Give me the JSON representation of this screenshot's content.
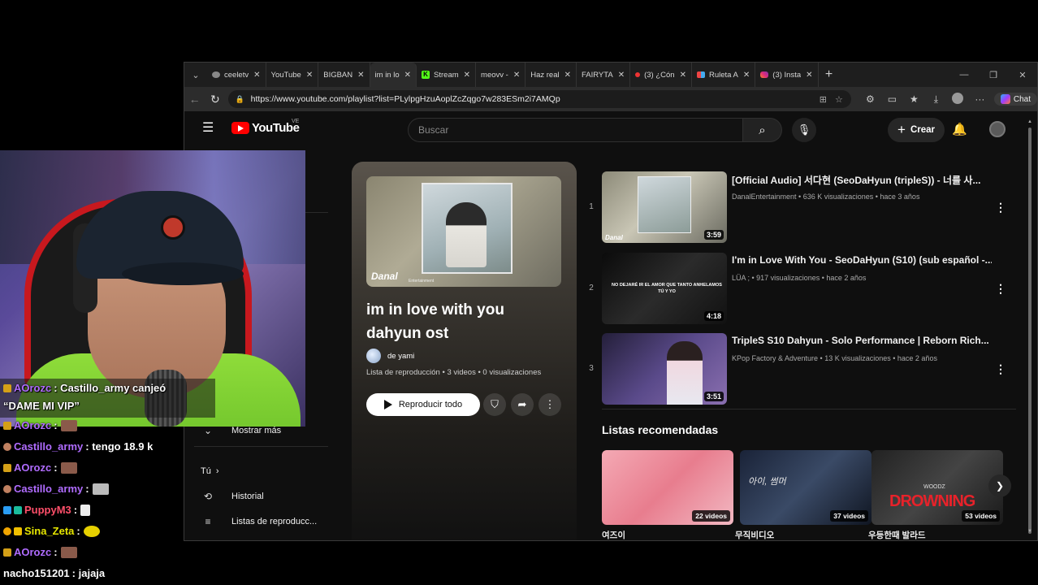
{
  "browser": {
    "tabs": [
      {
        "label": "ceeletv",
        "icon": "github-icon",
        "active": false
      },
      {
        "label": "YouTube",
        "icon": "youtube-icon",
        "active": false
      },
      {
        "label": "BIGBAN",
        "icon": "youtube-icon",
        "active": false
      },
      {
        "label": "im in lo",
        "icon": "youtube-icon",
        "active": true
      },
      {
        "label": "Stream",
        "icon": "kick-icon",
        "active": false
      },
      {
        "label": "meovv -",
        "icon": "youtube-icon",
        "active": false
      },
      {
        "label": "Haz real",
        "icon": "youtube-icon",
        "active": false
      },
      {
        "label": "FAIRYTA",
        "icon": "youtube-icon",
        "active": false
      },
      {
        "label": "(3) ¿Cón",
        "icon": "dot-icon",
        "active": false
      },
      {
        "label": "Ruleta A",
        "icon": "grid-icon",
        "active": false
      },
      {
        "label": "(3) Insta",
        "icon": "instagram-icon",
        "active": false
      }
    ],
    "url": "https://www.youtube.com/playlist?list=PLylpgHzuAoplZcZqgo7w283ESm2i7AMQp",
    "chat_label": "Chat"
  },
  "youtube": {
    "logo_text": "YouTube",
    "country_code": "VE",
    "search_placeholder": "Buscar",
    "create_label": "Crear",
    "sidebar": {
      "show_more": "Mostrar más",
      "you": "Tú",
      "history": "Historial",
      "playlists": "Listas de reproducc..."
    },
    "playlist": {
      "thumb_brand": "Danal",
      "thumb_brand_sub": "Entertainment",
      "title": "im in love with you dahyun ost",
      "owner": "de yami",
      "meta": "Lista de reproducción • 3 videos • 0 visualizaciones",
      "play_all": "Reproducir todo"
    },
    "videos": [
      {
        "index": "1",
        "title": "[Official Audio] 서다현 (SeoDaHyun (tripleS)) - 너를 사...",
        "meta": "DanalEntertainment • 636 K visualizaciones • hace 3 años",
        "duration": "3:59",
        "thumb_text": "Danal"
      },
      {
        "index": "2",
        "title": "I'm in Love With You - SeoDaHyun (S10) (sub español -...",
        "meta": "LÜA ; • 917 visualizaciones • hace 2 años",
        "duration": "4:18",
        "thumb_text": "NO DEJARÉ IR EL AMOR QUE TANTO ANHELAMOS TÚ Y YO"
      },
      {
        "index": "3",
        "title": "TripleS S10 Dahyun - Solo Performance | Reborn Rich...",
        "meta": "KPop Factory & Adventure • 13 K visualizaciones • hace 2 años",
        "duration": "3:51",
        "thumb_text": ""
      }
    ],
    "recommended_title": "Listas recomendadas",
    "recommended": [
      {
        "name": "여즈이",
        "count": "22 videos",
        "thumb_text": ""
      },
      {
        "name": "무직비디오",
        "count": "37 videos",
        "thumb_text": "아이, 썸머"
      },
      {
        "name": "우등한때 발라드",
        "count": "53 videos",
        "thumb_text": "DROWNING",
        "thumb_sub": "WOODZ"
      }
    ]
  },
  "chat": {
    "redeem_user": "AOrozc",
    "redeem_text": ": Castillo_army canjeó",
    "redeem_text2": "“DAME MI VIP”",
    "lines": [
      {
        "user": "AOrozc",
        "user_color": "#b06cff",
        "msg": ":",
        "emote": "pepe-emote"
      },
      {
        "user": "Castillo_army",
        "user_color": "#b06cff",
        "msg": ": tengo 18.9 k",
        "emote": ""
      },
      {
        "user": "AOrozc",
        "user_color": "#b06cff",
        "msg": ":",
        "emote": "pepe-emote"
      },
      {
        "user": "Castillo_army",
        "user_color": "#b06cff",
        "msg": ":",
        "emote": "cat-emote"
      },
      {
        "user": "PuppyM3",
        "user_color": "#ff4f6a",
        "msg": ":",
        "emote": "hand-emote"
      },
      {
        "user": "Sina_Zeta",
        "user_color": "#e6e600",
        "msg": ":",
        "emote": "duck-emote"
      },
      {
        "user": "AOrozc",
        "user_color": "#b06cff",
        "msg": ":",
        "emote": "pepe-emote"
      },
      {
        "user": "nacho151201",
        "user_color": "#ffffff",
        "msg": ": jajaja",
        "emote": ""
      }
    ]
  }
}
